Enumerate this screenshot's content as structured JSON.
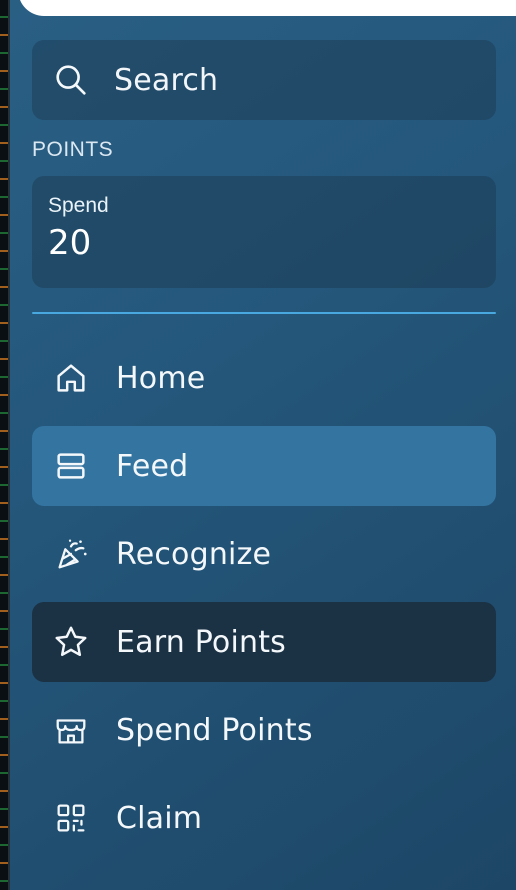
{
  "search": {
    "label": "Search",
    "icon": "search-icon"
  },
  "points_section": {
    "title": "POINTS",
    "card": {
      "label": "Spend",
      "value": "20"
    }
  },
  "nav": {
    "items": [
      {
        "label": "Home",
        "icon": "home-icon",
        "state": "default"
      },
      {
        "label": "Feed",
        "icon": "feed-icon",
        "state": "hover"
      },
      {
        "label": "Recognize",
        "icon": "party-popper-icon",
        "state": "default"
      },
      {
        "label": "Earn Points",
        "icon": "star-icon",
        "state": "active"
      },
      {
        "label": "Spend Points",
        "icon": "store-icon",
        "state": "default"
      },
      {
        "label": "Claim",
        "icon": "qr-code-icon",
        "state": "default"
      }
    ]
  },
  "colors": {
    "sidebar_top": "#2a5f84",
    "sidebar_bottom": "#1d4666",
    "hover_item": "#3474a1",
    "active_item": "#1b3144",
    "divider": "#4aa8e0"
  }
}
